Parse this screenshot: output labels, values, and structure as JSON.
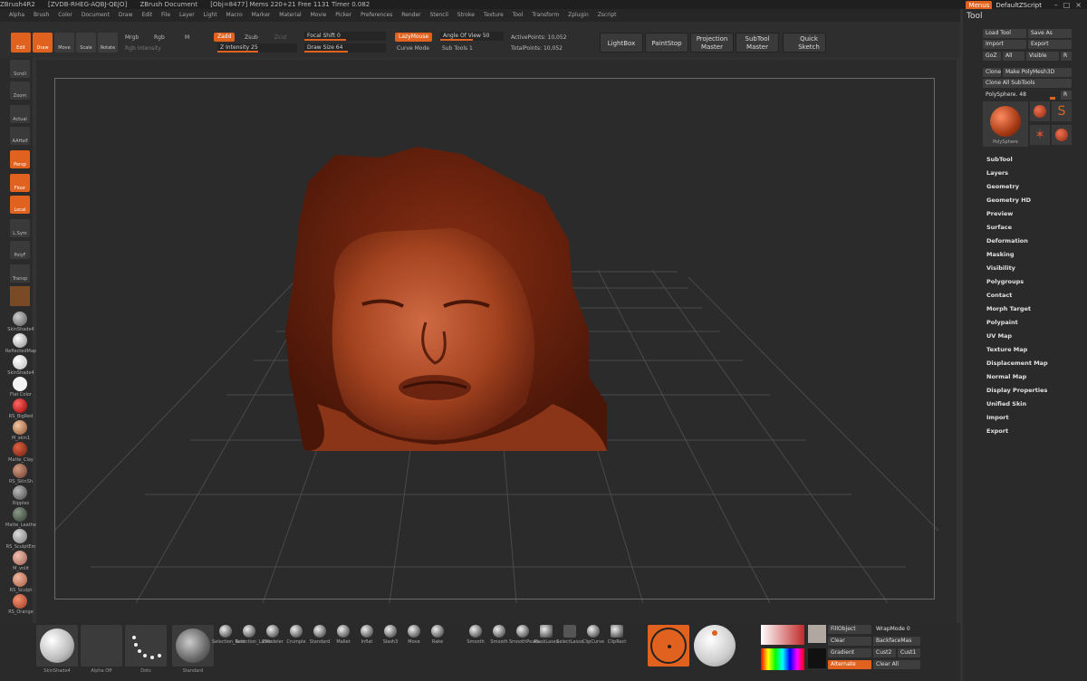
{
  "titlebar": {
    "app": "ZBrush4R2",
    "doc_id": "[ZVDB-RHEG-AQBJ-QEJO]",
    "doc": "ZBrush Document",
    "stats": "[Obj=8477] Mems 220+21 Free 1131 Timer 0.082"
  },
  "menubar": [
    "Alpha",
    "Brush",
    "Color",
    "Document",
    "Draw",
    "Edit",
    "File",
    "Layer",
    "Light",
    "Macro",
    "Marker",
    "Material",
    "Movie",
    "Picker",
    "Preferences",
    "Render",
    "Stencil",
    "Stroke",
    "Texture",
    "Tool",
    "Transform",
    "Zplugin",
    "Zscript"
  ],
  "topright": {
    "menus": "Menus",
    "script": "DefaultZScript"
  },
  "toolbar": {
    "edit": "Edit",
    "draw": "Draw",
    "move": "Move",
    "scale": "Scale",
    "rotate": "Rotate",
    "mrgb": "Mrgb",
    "rgb": "Rgb",
    "m": "M",
    "rgb_intensity": "Rgb Intensity",
    "zadd": "Zadd",
    "zsub": "Zsub",
    "zcut": "Zcut",
    "z_intensity": "Z Intensity 25",
    "focal_shift": "Focal Shift 0",
    "draw_size": "Draw Size 64",
    "lazymouse": "LazyMouse",
    "curve_mode": "Curve Mode",
    "angle_of_view": "Angle Of View 50",
    "sub_tools": "Sub Tools 1",
    "active_points": "ActivePoints: 10,052",
    "total_points": "TotalPoints: 10,052",
    "lightbox": "LightBox",
    "paintstop": "PaintStop",
    "projection_master": "Projection Master",
    "subtool_master": "SubTool Master",
    "quick_sketch": "Quick Sketch"
  },
  "leftshelf": {
    "buttons": [
      "Scroll",
      "Zoom",
      "Actual",
      "AAHalf",
      "Persp",
      "Floor",
      "Local",
      "L.Sym",
      "PolyF",
      "Transp"
    ],
    "materials": [
      "SkinShade4",
      "ReflectedMap",
      "SkinShade4",
      "Flat Color",
      "RS_BigRed",
      "M_skin1",
      "Matte_Clay",
      "RS_SkinSh",
      "Ripples",
      "Matte_Leather",
      "RS_SculptEm",
      "M_vnlit",
      "RS_Sculpt",
      "RS_Orange"
    ]
  },
  "rightpanel": {
    "title": "Tool",
    "buttons": [
      "Load Tool",
      "Save As",
      "Import",
      "Export",
      "GoZ",
      "All",
      "Visible",
      "R",
      "Clone",
      "Make PolyMesh3D",
      "Clone All SubTools"
    ],
    "current_tool": "PolySphere. 48",
    "thumbs": [
      "PolySphere",
      "Sphere3D",
      "SimpleBrush",
      "PolyMesh3D",
      "PolySph"
    ],
    "sections": [
      "SubTool",
      "Layers",
      "Geometry",
      "Geometry HD",
      "Preview",
      "Surface",
      "Deformation",
      "Masking",
      "Visibility",
      "Polygroups",
      "Contact",
      "Morph Target",
      "Polypaint",
      "UV Map",
      "Texture Map",
      "Displacement Map",
      "Normal Map",
      "Display Properties",
      "Unified Skin",
      "Import",
      "Export"
    ]
  },
  "bottom": {
    "thumbs": [
      "SkinShade4",
      "Alpha Off",
      "Dots",
      "Standard"
    ],
    "brushes_a": [
      "Selection_Rect",
      "Selection_Lasso",
      "ZModeler",
      "Crumple",
      "Standard",
      "Mallet",
      "Inflat",
      "Slash3",
      "Move",
      "Rake"
    ],
    "brushes_b": [
      "Smooth",
      "Smooth",
      "SmoothPeaks",
      "MaskLasso",
      "SelectLasso",
      "ClipCurve",
      "ClipRect",
      "ClipCircle",
      "SliceCurve",
      "MaskPen"
    ],
    "color": {
      "fill_object": "FillObject",
      "clear": "Clear",
      "gradient": "Gradient",
      "alternate": "Alternate",
      "wrapmode": "WrapMode 0",
      "backface": "BackfaceMas",
      "cust2": "Cust2",
      "cust1": "Cust1",
      "clear_all": "Clear All"
    }
  }
}
